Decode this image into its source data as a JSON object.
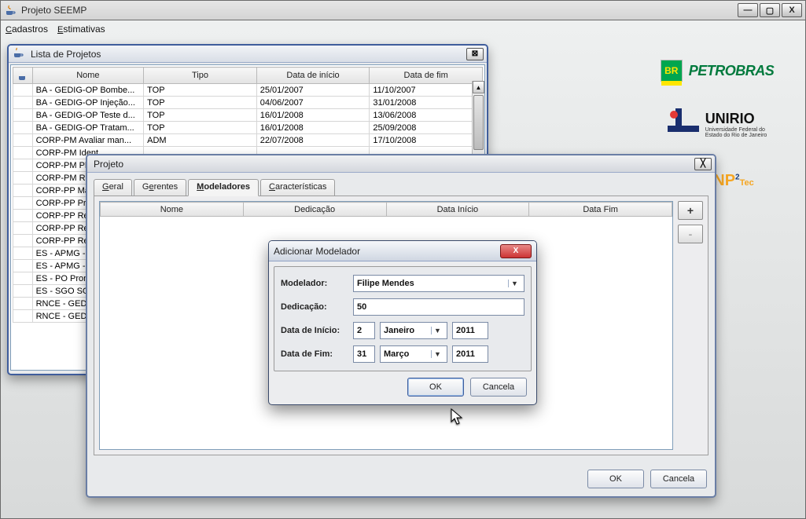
{
  "titlebar": {
    "title": "Projeto SEEMP"
  },
  "menubar": {
    "items": [
      "Cadastros",
      "Estimativas"
    ]
  },
  "lista": {
    "title": "Lista de Projetos",
    "columns": [
      "Nome",
      "Tipo",
      "Data de início",
      "Data de fim"
    ],
    "rows": [
      [
        "BA - GEDIG-OP Bombe...",
        "TOP",
        "25/01/2007",
        "11/10/2007"
      ],
      [
        "BA - GEDIG-OP Injeção...",
        "TOP",
        "04/06/2007",
        "31/01/2008"
      ],
      [
        "BA - GEDIG-OP Teste d...",
        "TOP",
        "16/01/2008",
        "13/06/2008"
      ],
      [
        "BA - GEDIG-OP Tratam...",
        "TOP",
        "16/01/2008",
        "25/09/2008"
      ],
      [
        "CORP-PM Avaliar man...",
        "ADM",
        "22/07/2008",
        "17/10/2008"
      ],
      [
        "CORP-PM Ident",
        "",
        "",
        ""
      ],
      [
        "CORP-PM Plan",
        "",
        "",
        ""
      ],
      [
        "CORP-PM Real",
        "",
        "",
        ""
      ],
      [
        "CORP-PP Mant",
        "",
        "",
        ""
      ],
      [
        "CORP-PP Prog",
        "",
        "",
        ""
      ],
      [
        "CORP-PP Reali",
        "",
        "",
        ""
      ],
      [
        "CORP-PP Regi",
        "",
        "",
        ""
      ],
      [
        "CORP-PP Regi",
        "",
        "",
        ""
      ],
      [
        "ES - APMG - AS",
        "",
        "",
        ""
      ],
      [
        "ES - APMG - TO",
        "",
        "",
        ""
      ],
      [
        "ES - PO Pronto",
        "",
        "",
        ""
      ],
      [
        "ES - SGO SGO",
        "",
        "",
        ""
      ],
      [
        "RNCE - GEDIG-",
        "",
        "",
        ""
      ],
      [
        "RNCE - GEDIG-",
        "",
        "",
        ""
      ]
    ]
  },
  "projeto": {
    "title": "Projeto",
    "tabs": [
      "Geral",
      "Gerentes",
      "Modeladores",
      "Características"
    ],
    "active_tab": "Modeladores",
    "sub_columns": [
      "Nome",
      "Dedicação",
      "Data Início",
      "Data Fim"
    ],
    "btn_add": "+",
    "btn_remove": "-",
    "btn_ok": "OK",
    "btn_cancel": "Cancela"
  },
  "modal": {
    "title": "Adicionar Modelador",
    "labels": {
      "modelador": "Modelador:",
      "dedicacao": "Dedicação:",
      "inicio": "Data de Início:",
      "fim": "Data de Fim:"
    },
    "modelador": "Filipe Mendes",
    "dedicacao": "50",
    "inicio_d": "2",
    "inicio_m": "Janeiro",
    "inicio_y": "2011",
    "fim_d": "31",
    "fim_m": "Março",
    "fim_y": "2011",
    "btn_ok": "OK",
    "btn_cancel": "Cancela"
  },
  "logos": {
    "petrobras": "PETROBRAS",
    "petrobras_br": "BR",
    "unirio": "UNIRIO",
    "unirio_sub1": "Universidade Federal do",
    "unirio_sub2": "Estado do Rio de Janeiro",
    "nptec": "Tec"
  }
}
